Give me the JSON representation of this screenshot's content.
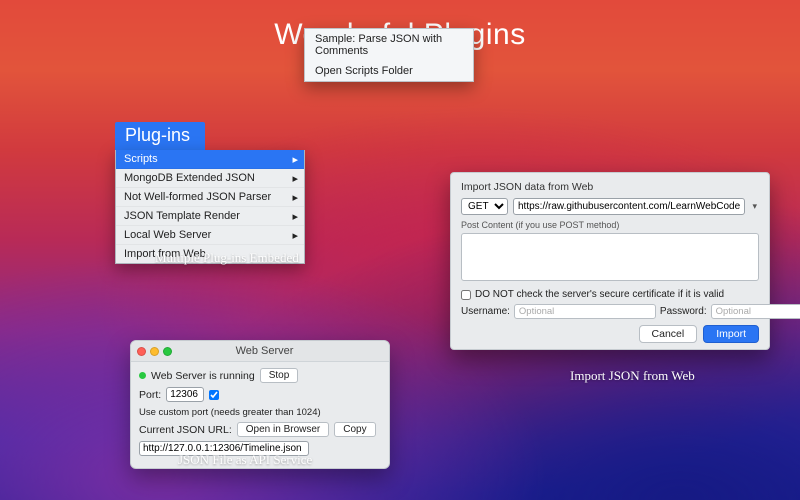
{
  "page_title": "Wonderful Plugins",
  "captions": {
    "embedded": "Multiple Plug-ins Embeded",
    "api_service": "JSON File as API Service",
    "import_web": "Import JSON from Web"
  },
  "plugins_menu": {
    "header": "Plug-ins",
    "items": [
      {
        "label": "Scripts",
        "selected": true,
        "has_sub": true
      },
      {
        "label": "MongoDB Extended JSON",
        "has_sub": true
      },
      {
        "label": "Not Well-formed JSON Parser",
        "has_sub": true
      },
      {
        "label": "JSON Template Render",
        "has_sub": true
      },
      {
        "label": "Local Web Server",
        "has_sub": true
      },
      {
        "label": "Import from Web",
        "has_sub": false
      }
    ],
    "submenu": [
      "Sample: Parse JSON with Comments",
      "Open Scripts Folder"
    ]
  },
  "web_server": {
    "window_title": "Web Server",
    "status_text": "Web Server is running",
    "stop_label": "Stop",
    "port_label": "Port:",
    "port_value": "12306",
    "custom_port_label": "Use custom port (needs greater than 1024)",
    "current_url_label": "Current JSON URL:",
    "open_browser_label": "Open in Browser",
    "copy_label": "Copy",
    "url_value": "http://127.0.0.1:12306/Timeline.json"
  },
  "import_dialog": {
    "title": "Import JSON data from Web",
    "method": "GET",
    "url_value": "https://raw.githubusercontent.com/LearnWebCode/json-example",
    "post_label": "Post Content (if you use POST method)",
    "cert_label": "DO NOT check the server's secure certificate if it is valid",
    "username_label": "Username:",
    "password_label": "Password:",
    "placeholder": "Optional",
    "cancel_label": "Cancel",
    "import_label": "Import"
  }
}
